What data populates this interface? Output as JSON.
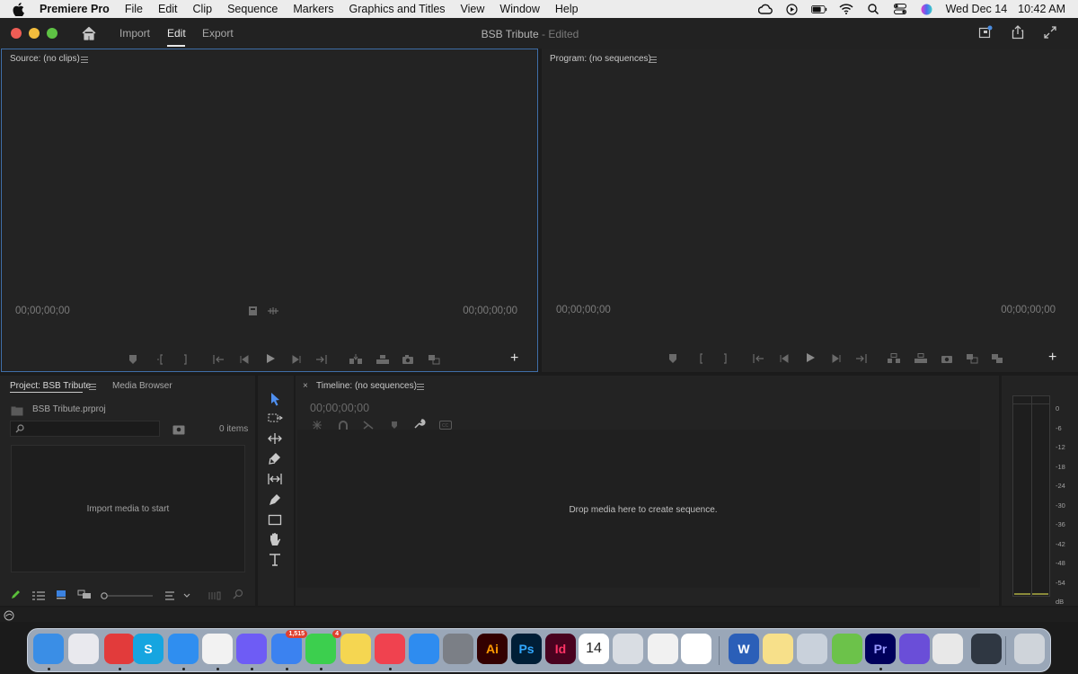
{
  "menubar": {
    "app_name": "Premiere Pro",
    "items": [
      "File",
      "Edit",
      "Clip",
      "Sequence",
      "Markers",
      "Graphics and Titles",
      "View",
      "Window",
      "Help"
    ],
    "date": "Wed Dec 14",
    "time": "10:42 AM",
    "status_icons": [
      "creative-cloud-icon",
      "play-circle-icon",
      "battery-icon",
      "wifi-icon",
      "search-icon",
      "control-center-icon",
      "siri-icon"
    ]
  },
  "header": {
    "tabs": [
      "Import",
      "Edit",
      "Export"
    ],
    "active_tab": "Edit",
    "doc_name": "BSB Tribute",
    "doc_state": "- Edited"
  },
  "source": {
    "title": "Source: (no clips)",
    "timecode_left": "00;00;00;00",
    "timecode_right": "00;00;00;00"
  },
  "program": {
    "title": "Program: (no sequences)",
    "timecode_left": "00;00;00;00",
    "timecode_right": "00;00;00;00"
  },
  "project": {
    "tab_active": "Project: BSB Tribute",
    "tab_other": "Media Browser",
    "file_name": "BSB Tribute.prproj",
    "search_placeholder": "",
    "items_count": "0 items",
    "empty_text": "Import media to start"
  },
  "timeline": {
    "title": "Timeline: (no sequences)",
    "timecode": "00;00;00;00",
    "drop_text": "Drop media here to create sequence."
  },
  "meters": {
    "scale": [
      "0",
      "-6",
      "-12",
      "-18",
      "-24",
      "-30",
      "-36",
      "-42",
      "-48",
      "-54",
      "dB"
    ]
  },
  "dock": {
    "apps": [
      {
        "name": "finder-icon",
        "label": "",
        "color": "#3a8ee6"
      },
      {
        "name": "launchpad-icon",
        "label": "",
        "color": "#e9e9ee"
      },
      {
        "name": "creative-cloud-icon",
        "label": "",
        "color": "#e23b3b"
      },
      {
        "name": "skype-icon",
        "label": "S",
        "color": "#16a5e0"
      },
      {
        "name": "safari-icon",
        "label": "",
        "color": "#2f8ef0"
      },
      {
        "name": "chrome-icon",
        "label": "",
        "color": "#f2f2f2"
      },
      {
        "name": "messenger-icon",
        "label": "",
        "color": "#6e5cf5"
      },
      {
        "name": "mail-icon",
        "label": "",
        "color": "#3b82f0"
      },
      {
        "name": "messages-icon",
        "label": "",
        "color": "#3ccf4e"
      },
      {
        "name": "notes-icon",
        "label": "",
        "color": "#f5d651"
      },
      {
        "name": "music-icon",
        "label": "",
        "color": "#f0424f"
      },
      {
        "name": "app-store-icon",
        "label": "",
        "color": "#2e8cf0"
      },
      {
        "name": "system-preferences-icon",
        "label": "",
        "color": "#7b7f86"
      },
      {
        "name": "illustrator-icon",
        "label": "Ai",
        "color": "#330000"
      },
      {
        "name": "photoshop-icon",
        "label": "Ps",
        "color": "#001e36"
      },
      {
        "name": "indesign-icon",
        "label": "Id",
        "color": "#49021f"
      },
      {
        "name": "calendar-icon",
        "label": "14",
        "color": "#ffffff"
      },
      {
        "name": "preview-icon",
        "label": "",
        "color": "#d9dde3"
      },
      {
        "name": "acrobat-icon",
        "label": "",
        "color": "#f1f1f1"
      },
      {
        "name": "slack-icon",
        "label": "",
        "color": "#ffffff"
      },
      {
        "name": "word-icon",
        "label": "W",
        "color": "#2b5fb8"
      },
      {
        "name": "notes-app-icon",
        "label": "",
        "color": "#f7e08a"
      },
      {
        "name": "image-capture-icon",
        "label": "",
        "color": "#c9d1db"
      },
      {
        "name": "sims-icon",
        "label": "",
        "color": "#6cc24a"
      },
      {
        "name": "premiere-icon",
        "label": "Pr",
        "color": "#00005b"
      },
      {
        "name": "imovie-icon",
        "label": "",
        "color": "#6a4ed8"
      },
      {
        "name": "podcast-mic-icon",
        "label": "",
        "color": "#e8e8e8"
      },
      {
        "name": "activity-monitor-icon",
        "label": "",
        "color": "#2f3742"
      },
      {
        "name": "trash-icon",
        "label": "",
        "color": "#cfd4da"
      }
    ],
    "badges": {
      "mail": "1,515",
      "messages": "4"
    }
  }
}
